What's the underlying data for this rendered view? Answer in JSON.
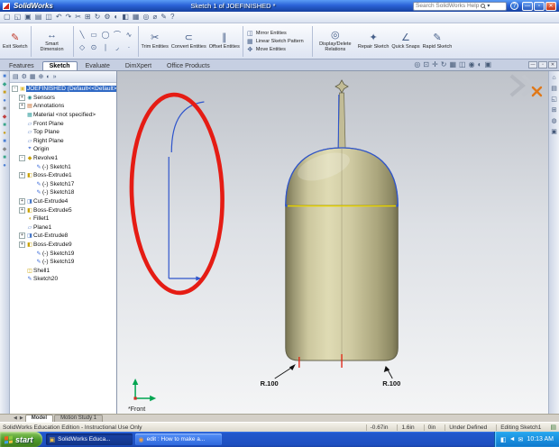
{
  "titlebar": {
    "brand": "SolidWorks",
    "title": "Sketch 1 of JOEFINISHED *",
    "search_placeholder": "Search SolidWorks Help",
    "minimize": "—",
    "maximize": "▫",
    "close": "✕",
    "help": "?"
  },
  "menubar": {
    "icons": [
      {
        "name": "new-file-icon",
        "glyph": "▢"
      },
      {
        "name": "open-file-icon",
        "glyph": "◱"
      },
      {
        "name": "save-icon",
        "glyph": "▣"
      },
      {
        "name": "print-icon",
        "glyph": "▤"
      },
      {
        "name": "print-preview-icon",
        "glyph": "◫"
      },
      {
        "name": "undo-icon",
        "glyph": "↶"
      },
      {
        "name": "redo-icon",
        "glyph": "↷"
      },
      {
        "name": "cut-icon",
        "glyph": "✂"
      },
      {
        "name": "copy-icon",
        "glyph": "⊞"
      },
      {
        "name": "rebuild-icon",
        "glyph": "↻"
      },
      {
        "name": "options-icon",
        "glyph": "⚙"
      },
      {
        "name": "appearance-icon",
        "glyph": "◐"
      },
      {
        "name": "section-view-icon",
        "glyph": "◧"
      },
      {
        "name": "view-orientation-icon",
        "glyph": "▦"
      },
      {
        "name": "zoom-icon",
        "glyph": "◎"
      },
      {
        "name": "measure-icon",
        "glyph": "⌀"
      },
      {
        "name": "sketch-icon",
        "glyph": "✎"
      },
      {
        "name": "help-icon",
        "glyph": "?"
      }
    ]
  },
  "ribbon": {
    "exit_sketch": "Exit Sketch",
    "smart_dimension": "Smart Dimension",
    "trim": "Trim Entities",
    "convert": "Convert Entities",
    "offset": "Offset Entities",
    "mirror": "Mirror Entities",
    "linear_pattern": "Linear Sketch Pattern",
    "move": "Move Entities",
    "relations": "Display/Delete Relations",
    "repair": "Repair Sketch",
    "quick_snaps": "Quick Snaps",
    "rapid": "Rapid Sketch",
    "icons": {
      "exit_sketch": "✎",
      "smart_dimension": "↔",
      "trim": "✂",
      "convert": "⊂",
      "offset": "∥",
      "mirror": "◫",
      "linear_pattern": "▦",
      "move": "✥",
      "relations": "◎",
      "repair": "✦",
      "quick_snaps": "∠",
      "rapid": "✎"
    },
    "sketch_tools": [
      {
        "name": "line-tool-icon",
        "glyph": "╲"
      },
      {
        "name": "rectangle-tool-icon",
        "glyph": "▭"
      },
      {
        "name": "circle-tool-icon",
        "glyph": "◯"
      },
      {
        "name": "arc-tool-icon",
        "glyph": "⌒"
      },
      {
        "name": "spline-tool-icon",
        "glyph": "∿"
      },
      {
        "name": "polygon-tool-icon",
        "glyph": "◇"
      },
      {
        "name": "ellipse-tool-icon",
        "glyph": "⊙"
      },
      {
        "name": "centerline-tool-icon",
        "glyph": "∣"
      },
      {
        "name": "sketch-fillet-tool-icon",
        "glyph": "◞"
      },
      {
        "name": "point-tool-icon",
        "glyph": "·"
      }
    ]
  },
  "tabs": {
    "items": [
      {
        "label": "Features",
        "cls": ""
      },
      {
        "label": "Sketch",
        "cls": "active"
      },
      {
        "label": "Evaluate",
        "cls": ""
      },
      {
        "label": "DimXpert",
        "cls": ""
      },
      {
        "label": "Office Products",
        "cls": ""
      }
    ],
    "doc_controls": [
      {
        "name": "doc-minimize-button",
        "glyph": "—"
      },
      {
        "name": "doc-restore-button",
        "glyph": "▫"
      },
      {
        "name": "doc-close-button",
        "glyph": "✕"
      }
    ]
  },
  "view_toolbar": {
    "icons": [
      {
        "name": "zoom-fit-icon",
        "glyph": "◎"
      },
      {
        "name": "zoom-area-icon",
        "glyph": "⊡"
      },
      {
        "name": "pan-icon",
        "glyph": "✛"
      },
      {
        "name": "rotate-view-icon",
        "glyph": "↻"
      },
      {
        "name": "view-orientation-icon",
        "glyph": "▦"
      },
      {
        "name": "display-style-icon",
        "glyph": "◫"
      },
      {
        "name": "hide-show-items-icon",
        "glyph": "◉"
      },
      {
        "name": "edit-appearance-icon",
        "glyph": "◐"
      },
      {
        "name": "apply-scene-icon",
        "glyph": "▣"
      }
    ]
  },
  "left_strip": {
    "icons": [
      {
        "name": "left-toolbar-icon-1",
        "glyph": "■",
        "color": "#4a7fd4"
      },
      {
        "name": "left-toolbar-icon-2",
        "glyph": "◆",
        "color": "#3aa68a"
      },
      {
        "name": "left-toolbar-icon-3",
        "glyph": "■",
        "color": "#c8a020"
      },
      {
        "name": "left-toolbar-icon-4",
        "glyph": "●",
        "color": "#4a7fd4"
      },
      {
        "name": "left-toolbar-icon-5",
        "glyph": "■",
        "color": "#888888"
      },
      {
        "name": "left-toolbar-icon-6",
        "glyph": "◆",
        "color": "#c04040"
      },
      {
        "name": "left-toolbar-icon-7",
        "glyph": "■",
        "color": "#3aa68a"
      },
      {
        "name": "left-toolbar-icon-8",
        "glyph": "●",
        "color": "#c8a020"
      },
      {
        "name": "left-toolbar-icon-9",
        "glyph": "■",
        "color": "#4a7fd4"
      },
      {
        "name": "left-toolbar-icon-10",
        "glyph": "◆",
        "color": "#888888"
      },
      {
        "name": "left-toolbar-icon-11",
        "glyph": "■",
        "color": "#3aa68a"
      },
      {
        "name": "left-toolbar-icon-12",
        "glyph": "●",
        "color": "#4a7fd4"
      }
    ]
  },
  "tree": {
    "header_icons": [
      {
        "name": "featuremanager-tab-icon",
        "glyph": "▤"
      },
      {
        "name": "propertymanager-tab-icon",
        "glyph": "⚙"
      },
      {
        "name": "configurationmanager-tab-icon",
        "glyph": "▦"
      },
      {
        "name": "dimxpertmanager-tab-icon",
        "glyph": "⊕"
      },
      {
        "name": "displaymanager-tab-icon",
        "glyph": "◐"
      },
      {
        "name": "panel-overflow-icon",
        "glyph": "»"
      }
    ],
    "items": [
      {
        "label": "JOEFINISHED (Default<<Default>_",
        "cls": "ind0 sel",
        "exp": "-",
        "glyph": "▣",
        "color": "#e0c040"
      },
      {
        "label": "Sensors",
        "cls": "ind1",
        "exp": "+",
        "glyph": "◉",
        "color": "#2e9090"
      },
      {
        "label": "Annotations",
        "cls": "ind1",
        "exp": "+",
        "glyph": "▤",
        "color": "#c06020"
      },
      {
        "label": "Material <not specified>",
        "cls": "ind1",
        "exp": "",
        "glyph": "▦",
        "color": "#38a0a0"
      },
      {
        "label": "Front Plane",
        "cls": "ind1",
        "exp": "",
        "glyph": "▱",
        "color": "#5078c0"
      },
      {
        "label": "Top Plane",
        "cls": "ind1",
        "exp": "",
        "glyph": "▱",
        "color": "#5078c0"
      },
      {
        "label": "Right Plane",
        "cls": "ind1",
        "exp": "",
        "glyph": "▱",
        "color": "#5078c0"
      },
      {
        "label": "Origin",
        "cls": "ind1",
        "exp": "",
        "glyph": "⌖",
        "color": "#2858c8"
      },
      {
        "label": "Revolve1",
        "cls": "ind1",
        "exp": "-",
        "glyph": "◆",
        "color": "#c8a000"
      },
      {
        "label": "(-) Sketch1",
        "cls": "ind2",
        "exp": "",
        "glyph": "✎",
        "color": "#3868d8"
      },
      {
        "label": "Boss-Extrude1",
        "cls": "ind1",
        "exp": "+",
        "glyph": "◧",
        "color": "#c8a000"
      },
      {
        "label": "(-) Sketch17",
        "cls": "ind2",
        "exp": "",
        "glyph": "✎",
        "color": "#3868d8"
      },
      {
        "label": "(-) Sketch18",
        "cls": "ind2",
        "exp": "",
        "glyph": "✎",
        "color": "#3868d8"
      },
      {
        "label": "Cut-Extrude4",
        "cls": "ind1",
        "exp": "+",
        "glyph": "◨",
        "color": "#4878c8"
      },
      {
        "label": "Boss-Extrude5",
        "cls": "ind1",
        "exp": "+",
        "glyph": "◧",
        "color": "#c8a000"
      },
      {
        "label": "Fillet1",
        "cls": "ind1",
        "exp": "",
        "glyph": "◖",
        "color": "#c8a000"
      },
      {
        "label": "Plane1",
        "cls": "ind1",
        "exp": "",
        "glyph": "▱",
        "color": "#5078c0"
      },
      {
        "label": "Cut-Extrude8",
        "cls": "ind1",
        "exp": "+",
        "glyph": "◨",
        "color": "#4878c8"
      },
      {
        "label": "Boss-Extrude9",
        "cls": "ind1",
        "exp": "+",
        "glyph": "◧",
        "color": "#c8a000"
      },
      {
        "label": "(-) Sketch19",
        "cls": "ind2",
        "exp": "",
        "glyph": "✎",
        "color": "#3868d8"
      },
      {
        "label": "(-) Sketch19",
        "cls": "ind2",
        "exp": "",
        "glyph": "✎",
        "color": "#3868d8"
      },
      {
        "label": "Shell1",
        "cls": "ind1",
        "exp": "",
        "glyph": "◫",
        "color": "#c8a000"
      },
      {
        "label": "Sketch20",
        "cls": "ind1",
        "exp": "",
        "glyph": "✎",
        "color": "#3868d8"
      }
    ]
  },
  "right_strip": {
    "icons": [
      {
        "name": "task-pane-resources-icon",
        "glyph": "⌂"
      },
      {
        "name": "task-pane-design-library-icon",
        "glyph": "▤"
      },
      {
        "name": "task-pane-file-explorer-icon",
        "glyph": "◱"
      },
      {
        "name": "task-pane-view-palette-icon",
        "glyph": "⊞"
      },
      {
        "name": "task-pane-appearances-icon",
        "glyph": "◍"
      },
      {
        "name": "task-pane-custom-props-icon",
        "glyph": "▣"
      }
    ]
  },
  "viewport": {
    "front_label": "*Front",
    "dim_left": "R.100",
    "dim_right": "R.100"
  },
  "model_tabs": {
    "items": [
      {
        "label": "Model",
        "cls": "active"
      },
      {
        "label": "Motion Study 1",
        "cls": ""
      }
    ]
  },
  "statusbar": {
    "left": "SolidWorks Education Edition - Instructional Use Only",
    "x": "-0.67in",
    "y": "1.6in",
    "z": "0in",
    "state": "Under Defined",
    "mode": "Editing Sketch1",
    "note_icon": "▤"
  },
  "taskbar": {
    "start": "start",
    "apps": [
      {
        "label": "SolidWorks Educa...",
        "cls": "active",
        "glyph": "▣",
        "color": "#f0c040"
      },
      {
        "label": "edit : How to make a...",
        "cls": "",
        "glyph": "◉",
        "color": "#f0a040"
      }
    ],
    "tray_icons": [
      {
        "name": "network-status-icon",
        "glyph": "◧"
      },
      {
        "name": "volume-icon",
        "glyph": "◄"
      },
      {
        "name": "messenger-icon",
        "glyph": "✉"
      }
    ],
    "time": "10:13 AM"
  }
}
